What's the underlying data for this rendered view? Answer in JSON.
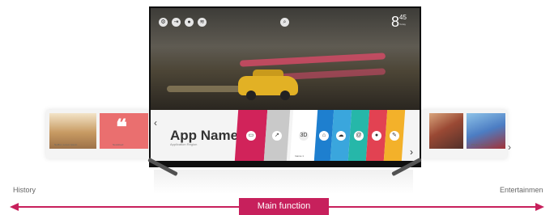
{
  "history": {
    "label": "History",
    "cards": [
      {
        "caption": "Netflix | Lorem Ipsum"
      },
      {
        "caption": "Newsfeed"
      }
    ]
  },
  "entertainment": {
    "label": "Entertainmen",
    "cards": [
      {
        "caption": ""
      },
      {
        "caption": "Playlist | Content"
      }
    ]
  },
  "tv": {
    "status_icons": [
      "settings-icon",
      "input-icon",
      "user-icon",
      "wifi-icon"
    ],
    "center_icon": "search-icon",
    "clock": {
      "hour": "8",
      "minute": "45",
      "sub": "Today"
    },
    "launcher": {
      "app_title": "App Name",
      "app_subtitle": "Application Region",
      "cards": [
        {
          "name": "tv",
          "color": "#d1235a",
          "icon": "▭",
          "caption": ""
        },
        {
          "name": "browser",
          "color": "#c9c9c9",
          "icon": "↗",
          "caption": ""
        },
        {
          "name": "3d",
          "color": "#ffffff",
          "icon": "3D",
          "caption": "Game 1"
        },
        {
          "name": "home",
          "color": "#1e7fcf",
          "icon": "⌂",
          "caption": ""
        },
        {
          "name": "cloud",
          "color": "#3aa6dd",
          "icon": "☁",
          "caption": ""
        },
        {
          "name": "smart",
          "color": "#26b7a9",
          "icon": "@",
          "caption": ""
        },
        {
          "name": "chat",
          "color": "#e24252",
          "icon": "●",
          "caption": ""
        },
        {
          "name": "note",
          "color": "#f3b12a",
          "icon": "✎",
          "caption": ""
        }
      ]
    }
  },
  "footer": {
    "main_function": "Main function"
  },
  "colors": {
    "accent": "#c7205c"
  }
}
